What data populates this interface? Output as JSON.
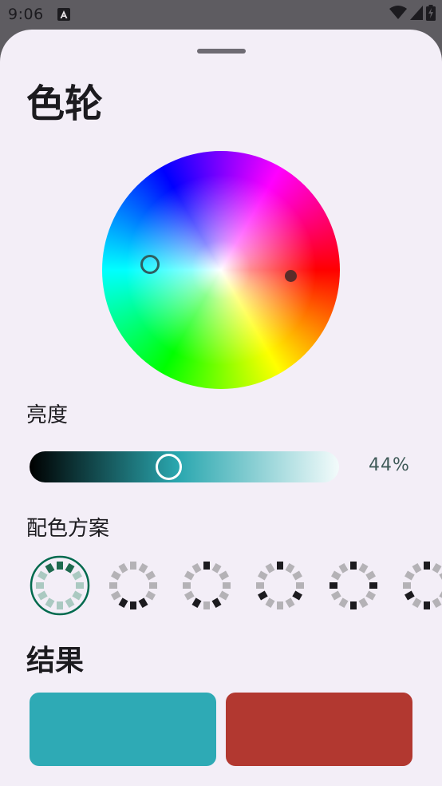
{
  "status_bar": {
    "time": "9:06"
  },
  "title": "色轮",
  "brightness": {
    "label": "亮度",
    "value": "44%"
  },
  "schemes": {
    "label": "配色方案",
    "items": [
      {
        "name": "scheme-analogous",
        "selected": true
      },
      {
        "name": "scheme-complementary",
        "selected": false
      },
      {
        "name": "scheme-split-complementary",
        "selected": false
      },
      {
        "name": "scheme-triadic",
        "selected": false
      },
      {
        "name": "scheme-tetradic",
        "selected": false
      },
      {
        "name": "scheme-square",
        "selected": false
      }
    ]
  },
  "result": {
    "label": "结果",
    "colors": [
      "#2eaab5",
      "#b23830"
    ]
  },
  "colors": {
    "sheet_bg": "#f3eef7",
    "accent": "#006a4e",
    "selected_segment": "#1e6a4f",
    "muted_segment": "#aac9c1"
  }
}
